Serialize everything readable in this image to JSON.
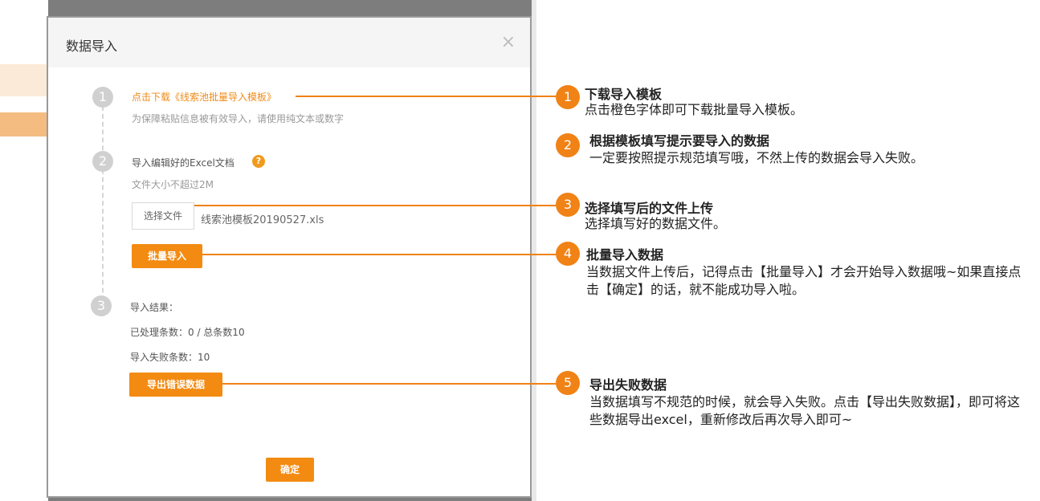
{
  "modal": {
    "title": "数据导入",
    "close_glyph": "×",
    "steps": [
      {
        "num": "1",
        "link": "点击下载《线索池批量导入模板》",
        "hint": "为保障粘贴信息被有效导入，请使用纯文本或数字"
      },
      {
        "num": "2",
        "label": "导入编辑好的Excel文档",
        "help_glyph": "?",
        "hint": "文件大小不超过2M",
        "choose_file_label": "选择文件",
        "file_name": "线索池模板20190527.xls",
        "batch_import_label": "批量导入"
      },
      {
        "num": "3",
        "label": "导入结果：",
        "processed": "已处理条数：0 / 总条数10",
        "failed": "导入失败条数：10",
        "export_errors_label": "导出错误数据"
      }
    ],
    "confirm_label": "确定"
  },
  "callouts": [
    {
      "num": "1",
      "title": "下载导入模板",
      "desc": "点击橙色字体即可下载批量导入模板。"
    },
    {
      "num": "2",
      "title": "根据模板填写提示要导入的数据",
      "desc": "一定要按照提示规范填写哦，不然上传的数据会导入失败。"
    },
    {
      "num": "3",
      "title": "选择填写后的文件上传",
      "desc": "选择填写好的数据文件。"
    },
    {
      "num": "4",
      "title": "批量导入数据",
      "desc": "当数据文件上传后，记得点击【批量导入】才会开始导入数据哦~如果直接点击【确定】的话，就不能成功导入啦。"
    },
    {
      "num": "5",
      "title": "导出失败数据",
      "desc": "当数据填写不规范的时候，就会导入失败。点击【导出失败数据】，即可将这些数据导出excel，重新修改后再次导入即可~"
    }
  ],
  "colors": {
    "accent": "#f08216",
    "button": "#f38b12",
    "step_circle": "#d0d0d0"
  }
}
